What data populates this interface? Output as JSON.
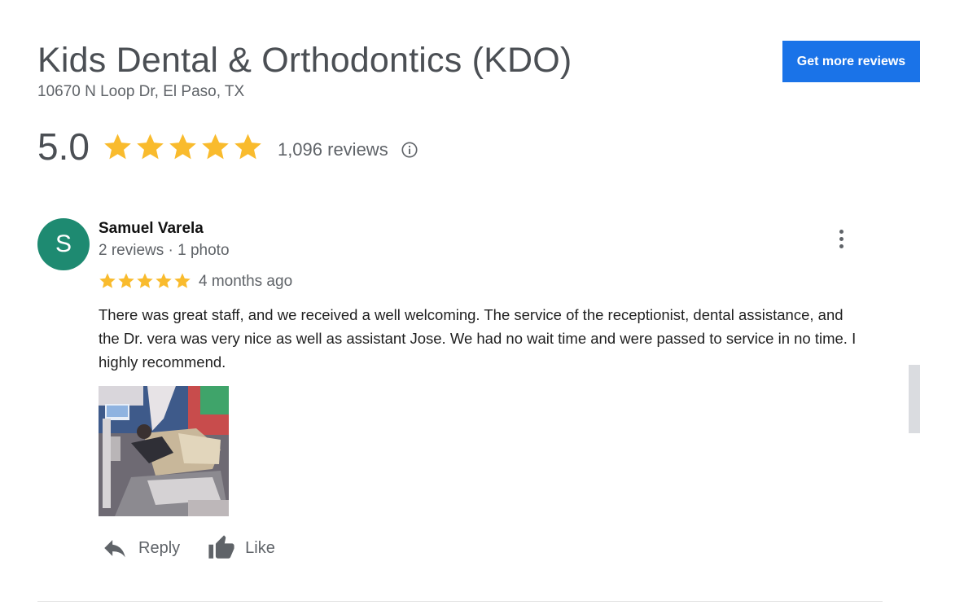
{
  "business": {
    "name": "Kids Dental & Orthodontics (KDO)",
    "address": "10670 N Loop Dr, El Paso, TX"
  },
  "header": {
    "get_more_reviews_label": "Get more reviews",
    "accent_color": "#1a73e8"
  },
  "rating": {
    "value": "5.0",
    "stars": 5,
    "review_count": "1,096 reviews",
    "star_color": "#f9bb2d",
    "info_icon": "info-icon"
  },
  "review": {
    "avatar_letter": "S",
    "avatar_color": "#1e8a71",
    "reviewer_name": "Samuel Varela",
    "reviewer_meta": "2 reviews · 1 photo",
    "stars": 5,
    "time_ago": "4 months ago",
    "text": "There was great staff, and we received a well welcoming. The service of the receptionist, dental assistance, and the Dr. vera was very nice as well as assistant Jose. We had no wait time and were passed to service in no time. I highly recommend.",
    "more_icon": "more-vert-icon",
    "photo_icon": "review-photo"
  },
  "actions": {
    "reply_label": "Reply",
    "like_label": "Like",
    "reply_icon": "reply-icon",
    "like_icon": "thumbs-up-icon"
  }
}
